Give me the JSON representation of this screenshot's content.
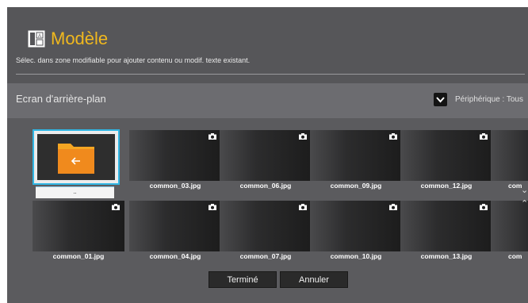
{
  "header": {
    "title": "Modèle",
    "subtitle": "Sélec. dans zone modifiable pour ajouter contenu ou modif. texte existant.",
    "title_color": "#f0b81e",
    "icon": "template-layout-icon"
  },
  "bar": {
    "title": "Ecran d'arrière-plan",
    "device_label": "Périphérique : Tous",
    "device_icon": "chevron-down-icon"
  },
  "folder": {
    "caption": "..",
    "icon": "folder-back-icon",
    "selected_border": "#30b6e4"
  },
  "files": {
    "row1": [
      "common_03.jpg",
      "common_06.jpg",
      "common_09.jpg",
      "common_12.jpg",
      "com"
    ],
    "row2": [
      "common_01.jpg",
      "common_04.jpg",
      "common_07.jpg",
      "common_10.jpg",
      "common_13.jpg",
      "com"
    ]
  },
  "buttons": {
    "done": "Terminé",
    "cancel": "Annuler"
  },
  "icons": {
    "camera": "camera-icon",
    "scroll_down": "chevron-down-icon",
    "scroll_up": "chevron-up-icon"
  }
}
